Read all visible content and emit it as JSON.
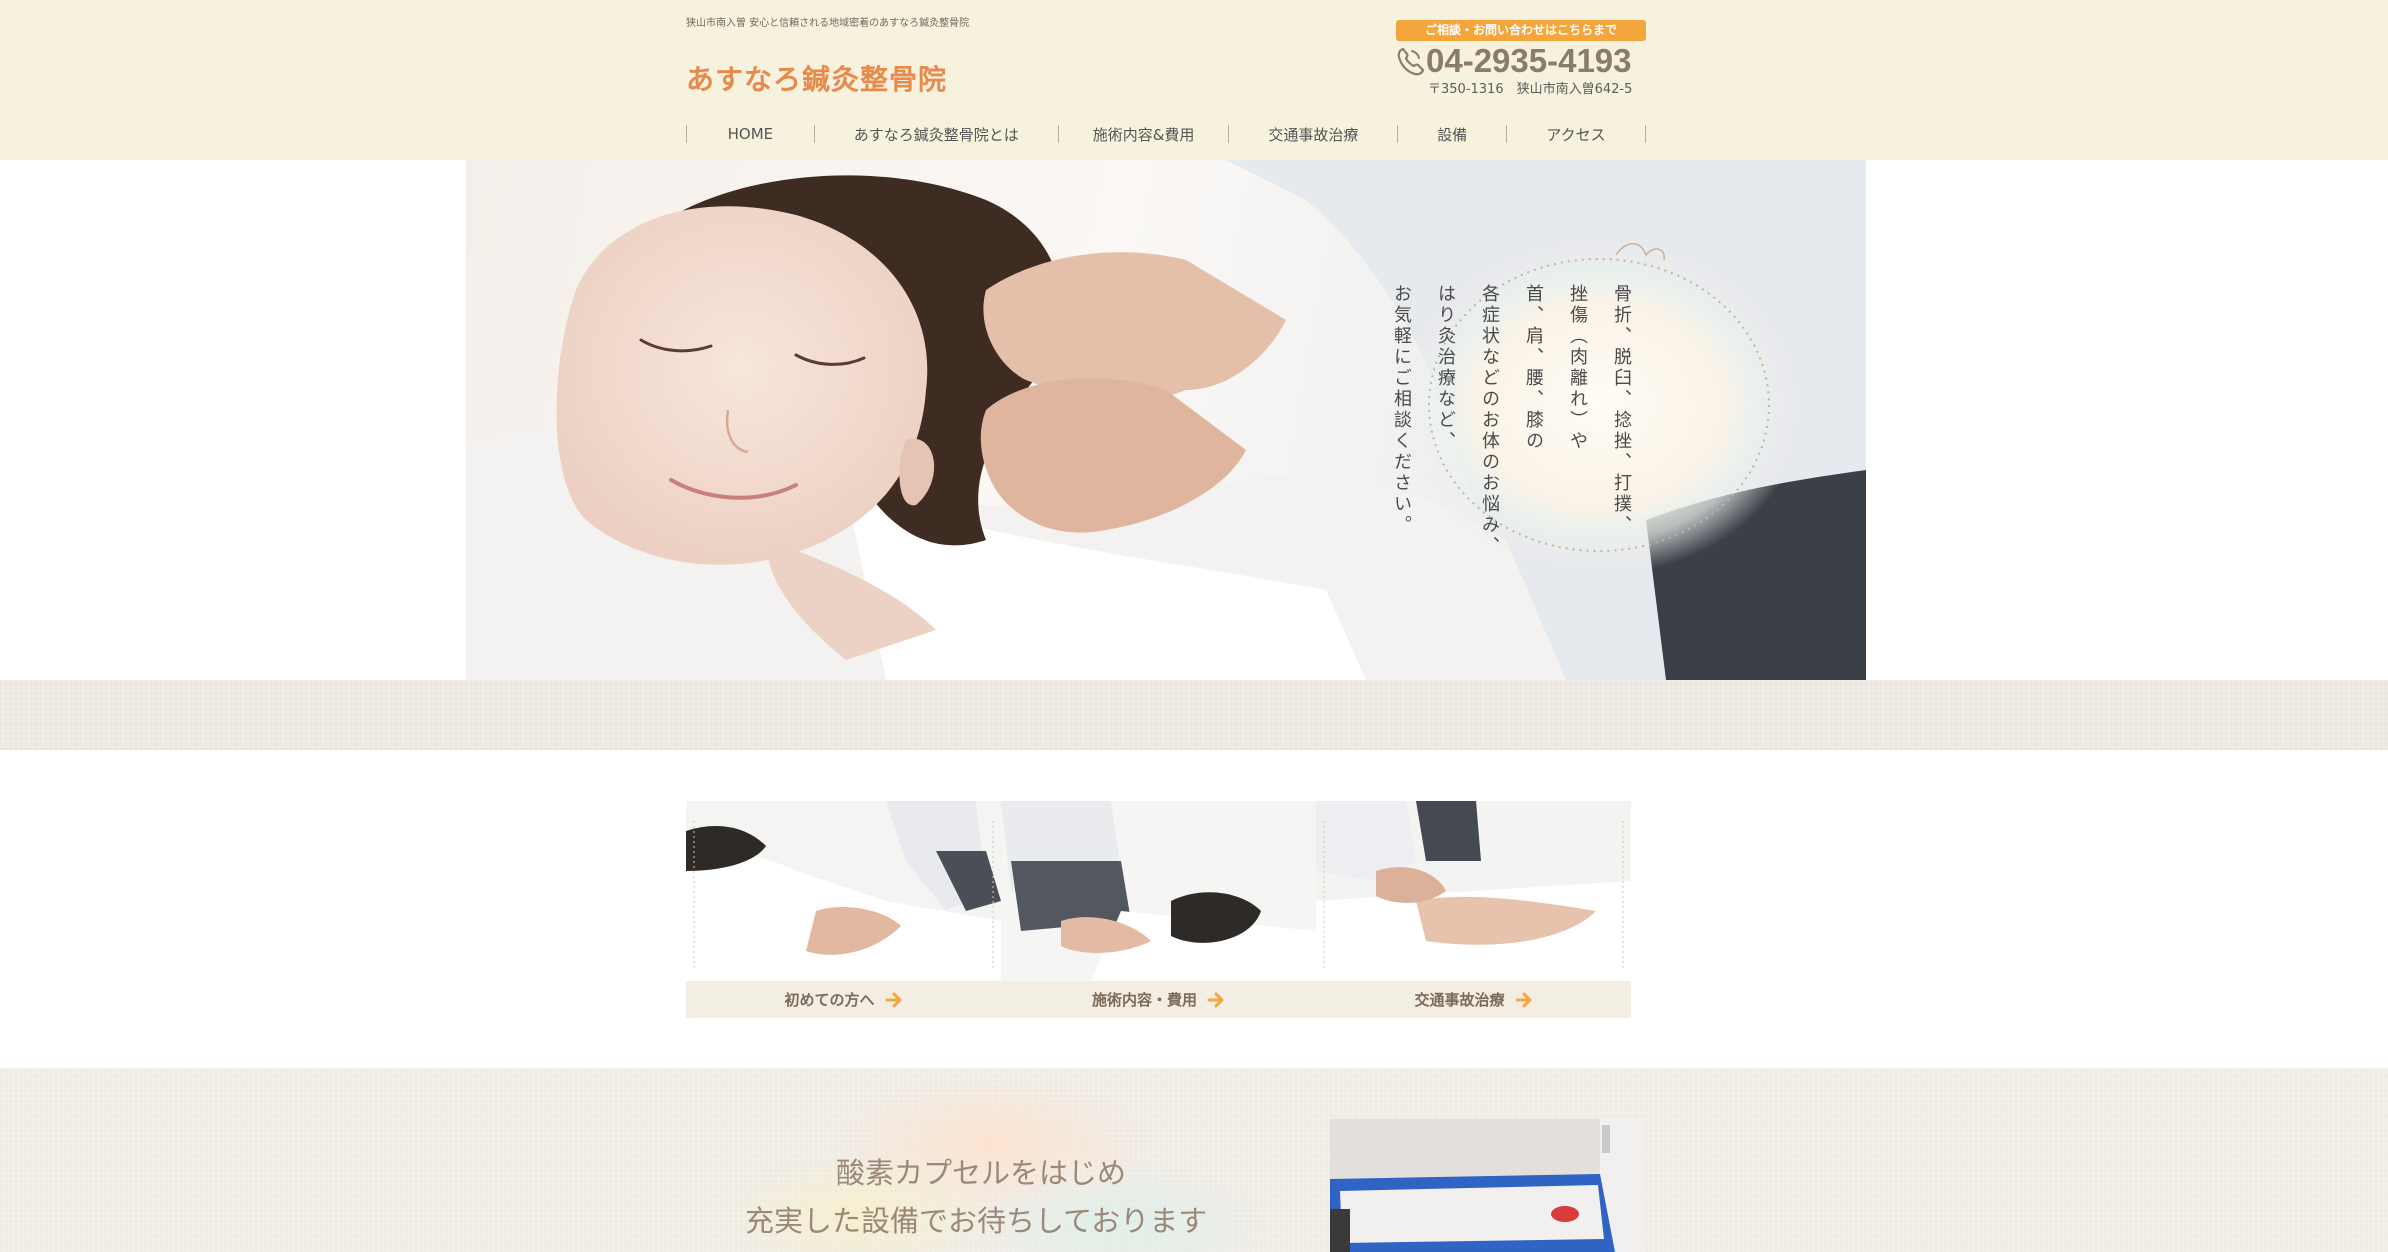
{
  "header": {
    "tagline": "狭山市南入曽 安心と信頼される地域密着のあすなろ鍼灸整骨院",
    "logo": "あすなろ鍼灸整骨院",
    "contact_banner": "ご相談・お問い合わせはこちらまで",
    "phone": "04-2935-4193",
    "address": "〒350-1316　狭山市南入曽642-5"
  },
  "nav": [
    {
      "label": "HOME"
    },
    {
      "label": "あすなろ鍼灸整骨院とは"
    },
    {
      "label": "施術内容&費用"
    },
    {
      "label": "交通事故治療"
    },
    {
      "label": "設備"
    },
    {
      "label": "アクセス"
    }
  ],
  "hero": {
    "lines": [
      "骨折、脱臼、捻挫、打撲、",
      "挫傷（肉離れ）や",
      "首、肩、腰、膝の",
      "各症状などのお体のお悩み、",
      "はり灸治療など、",
      "お気軽にご相談ください。"
    ]
  },
  "cards": [
    {
      "label": "初めての方へ"
    },
    {
      "label": "施術内容・費用"
    },
    {
      "label": "交通事故治療"
    }
  ],
  "facility": {
    "line1": "酸素カプセルをはじめ",
    "line2": "充実した設備でお待ちしております"
  },
  "colors": {
    "header_bg": "#f6f2de",
    "logo": "#e88a4c",
    "accent_orange": "#f4a53c",
    "phone": "#8a7b6a",
    "card_label": "#7c6a5a"
  }
}
